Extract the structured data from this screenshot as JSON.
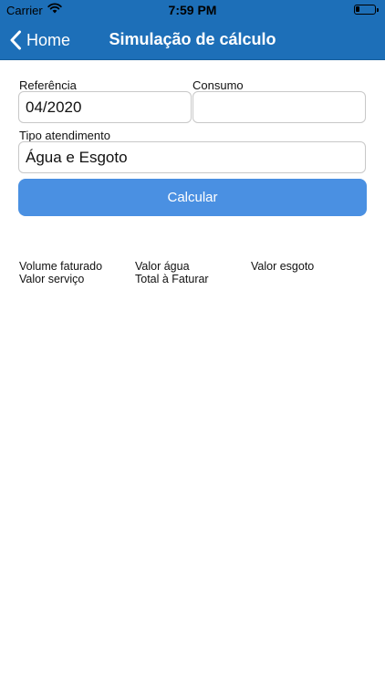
{
  "status_bar": {
    "carrier": "Carrier",
    "time": "7:59 PM"
  },
  "navbar": {
    "back_label": "Home",
    "title": "Simulação de cálculo",
    "background_color": "#1d6fb8"
  },
  "form": {
    "referencia_label": "Referência",
    "referencia_value": "04/2020",
    "consumo_label": "Consumo",
    "consumo_value": "",
    "tipo_label": "Tipo atendimento",
    "tipo_value": "Água e Esgoto",
    "calcular_label": "Calcular",
    "button_color": "#4a90e2"
  },
  "results": {
    "volume_faturado": "Volume faturado",
    "valor_agua": "Valor água",
    "valor_esgoto": "Valor esgoto",
    "valor_servico": "Valor serviço",
    "total_a_faturar": "Total à Faturar"
  }
}
